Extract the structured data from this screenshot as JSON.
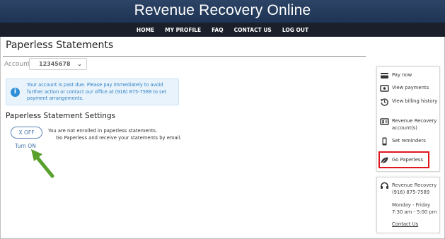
{
  "header": {
    "title": "Revenue Recovery Online"
  },
  "nav": {
    "items": [
      {
        "label": "HOME"
      },
      {
        "label": "MY PROFILE"
      },
      {
        "label": "FAQ"
      },
      {
        "label": "CONTACT US"
      },
      {
        "label": "LOG OUT"
      }
    ]
  },
  "page": {
    "title": "Paperless Statements"
  },
  "account": {
    "label": "Account",
    "selected": "12345678"
  },
  "alert": {
    "icon": "info-icon",
    "text": "Your account is past due. Please pay immediately to avoid further action or contact our office at (916) 875-7589 to set payment arrangements."
  },
  "settings": {
    "title": "Paperless Statement Settings",
    "toggle_label": "X OFF",
    "turn_on_label": "Turn ON",
    "status_line1": "You are not enrolled in paperless statements.",
    "status_line2": "Go Paperless and receive your statements by email."
  },
  "sidebar": {
    "items": [
      {
        "label": "Pay now",
        "icon": "card-icon"
      },
      {
        "label": "View payments",
        "icon": "money-icon"
      },
      {
        "label": "View billing history",
        "icon": "history-icon"
      },
      {
        "label": "Revenue Recovery account(s)",
        "icon": "id-card-icon"
      },
      {
        "label": "Set reminders",
        "icon": "phone-icon"
      },
      {
        "label": "Go Paperless",
        "icon": "leaf-icon"
      }
    ]
  },
  "contact": {
    "icon": "headset-icon",
    "name": "Revenue Recovery",
    "phone": "(916) 875-7589",
    "days": "Monday - Friday",
    "hours": "7:30 am - 5:00 pm",
    "link": "Contact Us"
  },
  "colors": {
    "banner": "#1f3454",
    "navbar": "#1a1f29",
    "alert_text": "#2f7fc4",
    "highlight": "#e0141e",
    "arrow": "#5aa02c"
  }
}
